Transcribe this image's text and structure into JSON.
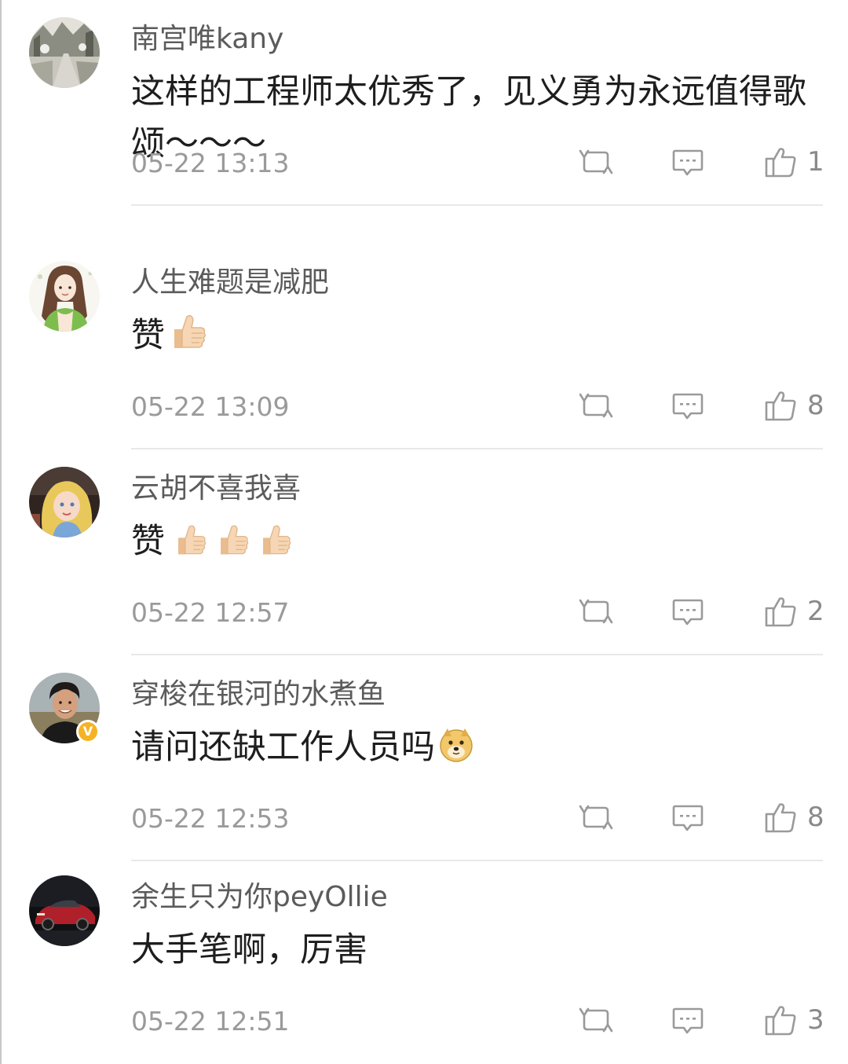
{
  "comments": [
    {
      "username": "南宫唯kany",
      "text": "这样的工程师太优秀了，见义勇为永远值得歌颂～～～",
      "timestamp": "05-22 13:13",
      "likes": "1",
      "avatar": "snowy-street-avatar",
      "verified": false
    },
    {
      "username": "人生难题是减肥",
      "text": "赞",
      "emoji": [
        "thumbs-up"
      ],
      "timestamp": "05-22 13:09",
      "likes": "8",
      "avatar": "girl-illustration-avatar",
      "verified": false
    },
    {
      "username": "云胡不喜我喜",
      "text": "赞",
      "emoji": [
        "thumbs-up",
        "thumbs-up",
        "thumbs-up"
      ],
      "timestamp": "05-22 12:57",
      "likes": "2",
      "avatar": "anime-girl-avatar",
      "verified": false
    },
    {
      "username": "穿梭在银河的水煮鱼",
      "text": "请问还缺工作人员吗",
      "emoji": [
        "doge"
      ],
      "timestamp": "05-22 12:53",
      "likes": "8",
      "avatar": "man-photo-avatar",
      "verified": true
    },
    {
      "username": "余生只为你peyOllie",
      "text": "大手笔啊，厉害",
      "timestamp": "05-22 12:51",
      "likes": "3",
      "avatar": "red-car-avatar",
      "verified": false
    }
  ],
  "icons": {
    "repost": "repost-icon",
    "comment": "comment-icon",
    "like": "like-icon"
  },
  "colors": {
    "username": "#5b5b5b",
    "text": "#1e1e1e",
    "meta": "#9a9a9a",
    "verified": "#f5b324"
  }
}
